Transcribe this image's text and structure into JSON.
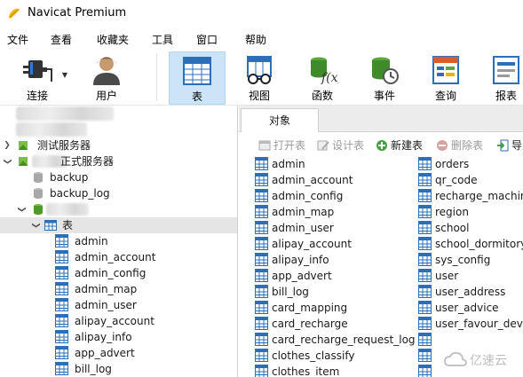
{
  "app": {
    "title": "Navicat Premium"
  },
  "menu": [
    "文件",
    "查看",
    "收藏夹",
    "工具",
    "窗口",
    "帮助"
  ],
  "toolbar": {
    "connect": "连接",
    "user": "用户",
    "table": "表",
    "view": "视图",
    "function": "函数",
    "event": "事件",
    "query": "查询",
    "report": "报表"
  },
  "sidebar": {
    "test_server": "测试服务器",
    "formal_server_suffix": "正式服务器",
    "databases": [
      "backup",
      "backup_log"
    ],
    "tables_node": "表",
    "tables": [
      "admin",
      "admin_account",
      "admin_config",
      "admin_map",
      "admin_user",
      "alipay_account",
      "alipay_info",
      "app_advert",
      "bill_log"
    ]
  },
  "tabs": {
    "objects": "对象"
  },
  "object_toolbar": {
    "open": "打开表",
    "design": "设计表",
    "new": "新建表",
    "delete": "删除表",
    "import": "导入"
  },
  "objects": {
    "col1": [
      "admin",
      "admin_account",
      "admin_config",
      "admin_map",
      "admin_user",
      "alipay_account",
      "alipay_info",
      "app_advert",
      "bill_log",
      "card_mapping",
      "card_recharge",
      "card_recharge_request_log",
      "clothes_classify",
      "clothes_item"
    ],
    "col2": [
      "orders",
      "qr_code",
      "recharge_machine",
      "region",
      "school",
      "school_dormitory",
      "sys_config",
      "user",
      "user_address",
      "user_advice",
      "user_favour_device",
      "",
      "",
      ""
    ]
  },
  "watermark": {
    "text": "亿速云"
  }
}
